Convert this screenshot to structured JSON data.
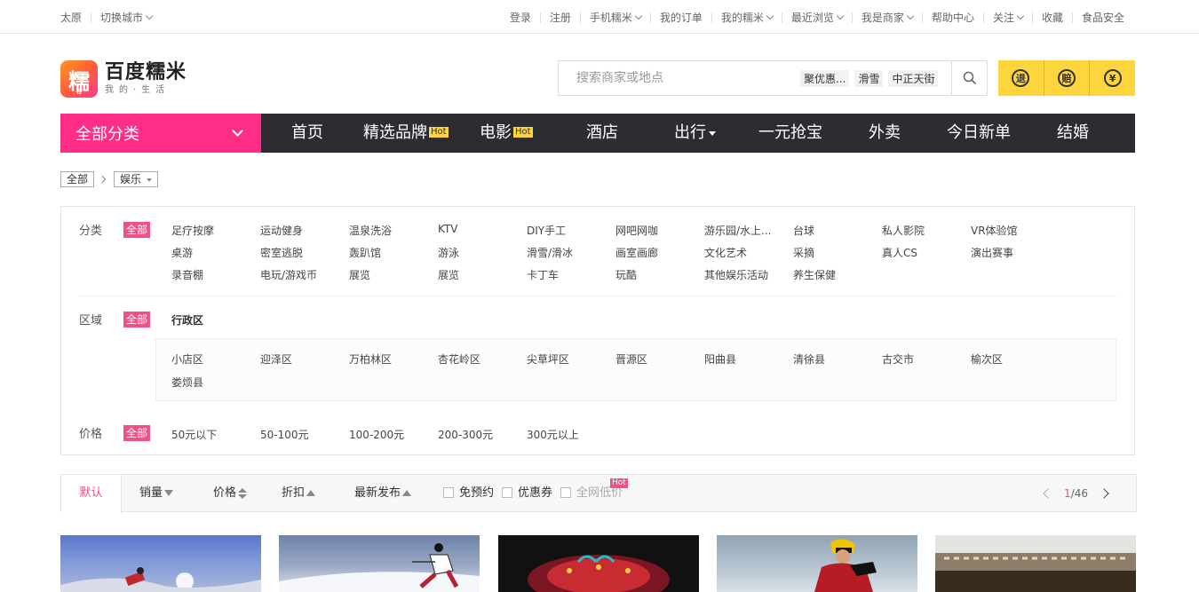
{
  "topbar": {
    "city": "太原",
    "switch_city": "切换城市",
    "links": [
      "登录",
      "注册",
      "手机糯米",
      "我的订单",
      "我的糯米",
      "最近浏览",
      "我是商家",
      "帮助中心",
      "关注",
      "收藏",
      "食品安全"
    ]
  },
  "logo": {
    "char": "糯",
    "mini": "谷",
    "name": "百度糯米",
    "slogan": "我的·生活"
  },
  "search": {
    "placeholder": "搜索商家或地点",
    "tags": [
      "聚优惠...",
      "滑雪",
      "中正天街"
    ]
  },
  "promises": [
    "退",
    "赔",
    "¥"
  ],
  "nav": {
    "all_categories": "全部分类",
    "items": [
      "首页",
      "精选品牌",
      "电影",
      "酒店",
      "出行",
      "一元抢宝",
      "外卖",
      "今日新单",
      "结婚"
    ],
    "hot_label": "Hot"
  },
  "breadcrumb": {
    "root": "全部",
    "current": "娱乐"
  },
  "filters": {
    "all_label": "全部",
    "category": {
      "label": "分类",
      "rows": [
        [
          "足疗按摩",
          "运动健身",
          "温泉洗浴",
          "KTV",
          "DIY手工",
          "网吧网咖",
          "游乐园/水上...",
          "台球",
          "私人影院",
          "VR体验馆"
        ],
        [
          "桌游",
          "密室逃脱",
          "轰趴馆",
          "游泳",
          "滑雪/滑冰",
          "画室画廊",
          "文化艺术",
          "采摘",
          "真人CS",
          "演出赛事"
        ],
        [
          "录音棚",
          "电玩/游戏币",
          "展览",
          "展览",
          "卡丁车",
          "玩酷",
          "其他娱乐活动",
          "养生保健"
        ]
      ]
    },
    "region": {
      "label": "区域",
      "district_title": "行政区",
      "districts": [
        [
          "小店区",
          "迎泽区",
          "万柏林区",
          "杏花岭区",
          "尖草坪区",
          "晋源区",
          "阳曲县",
          "清徐县",
          "古交市",
          "榆次区"
        ],
        [
          "娄烦县"
        ]
      ]
    },
    "price": {
      "label": "价格",
      "options": [
        "50元以下",
        "50-100元",
        "100-200元",
        "200-300元",
        "300元以上"
      ]
    }
  },
  "sortbar": {
    "default": "默认",
    "sales": "销量",
    "price": "价格",
    "discount": "折扣",
    "newest": "最新发布",
    "no_booking": "免预约",
    "coupon": "优惠券",
    "lowest": "全网低价",
    "hot": "Hot",
    "page_current": "1",
    "page_total": "/46"
  }
}
